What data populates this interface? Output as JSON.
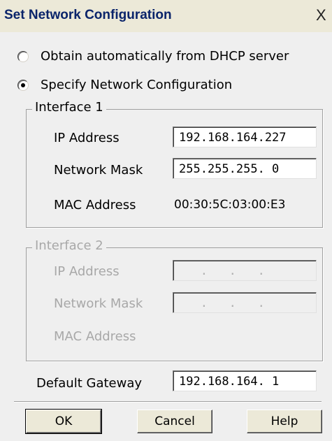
{
  "window": {
    "title": "Set Network Configuration",
    "close_glyph": "X"
  },
  "options": {
    "dhcp_label": "Obtain automatically from DHCP server",
    "dhcp_selected": false,
    "specify_label": "Specify Network Configuration",
    "specify_selected": true
  },
  "interface1": {
    "legend": "Interface 1",
    "ip_label": "IP Address",
    "ip_value": "192.168.164.227",
    "mask_label": "Network Mask",
    "mask_value": "255.255.255. 0",
    "mac_label": "MAC Address",
    "mac_value": "00:30:5C:03:00:E3"
  },
  "interface2": {
    "legend": "Interface 2",
    "ip_label": "IP Address",
    "ip_value": "   .   .   .",
    "mask_label": "Network Mask",
    "mask_value": "   .   .   .",
    "mac_label": "MAC Address",
    "enabled": false
  },
  "gateway": {
    "label": "Default Gateway",
    "value": "192.168.164. 1"
  },
  "buttons": {
    "ok": "OK",
    "cancel": "Cancel",
    "help": "Help"
  }
}
